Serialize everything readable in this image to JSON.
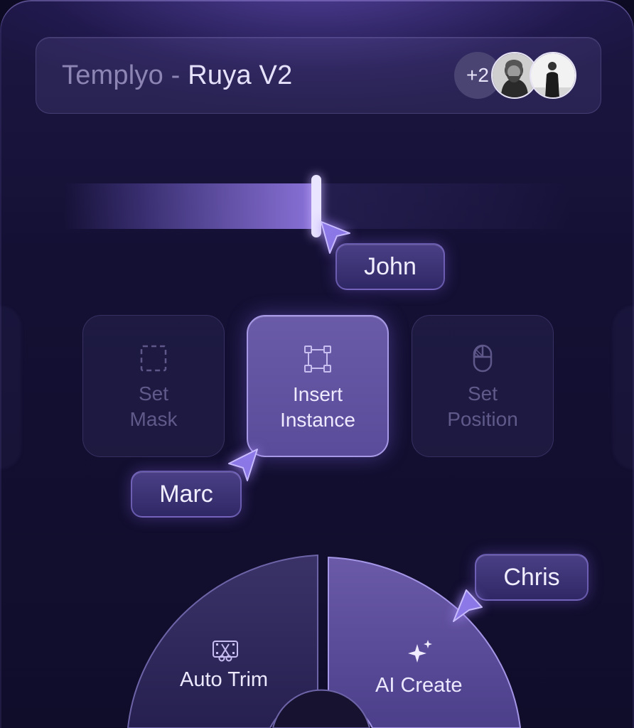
{
  "header": {
    "app_name": "Templyo",
    "separator": " - ",
    "project_name": "Ruya V2",
    "extra_collaborators": "+2"
  },
  "timeline": {
    "progress": 0.5
  },
  "collaborators": {
    "john": "John",
    "marc": "Marc",
    "chris": "Chris"
  },
  "tools": [
    {
      "line1": "Set",
      "line2": "Mask",
      "icon": "dashed-square-icon"
    },
    {
      "line1": "Insert",
      "line2": "Instance",
      "icon": "component-frame-icon"
    },
    {
      "line1": "Set",
      "line2": "Position",
      "icon": "mouse-icon"
    }
  ],
  "radial_menu": {
    "left_label": "Auto Trim",
    "left_icon": "film-scissors-icon",
    "right_label": "AI Create",
    "right_icon": "sparkles-icon"
  },
  "colors": {
    "accent": "#8a72d8",
    "active_tool": "#6a5ba8",
    "background": "#100d2b"
  }
}
